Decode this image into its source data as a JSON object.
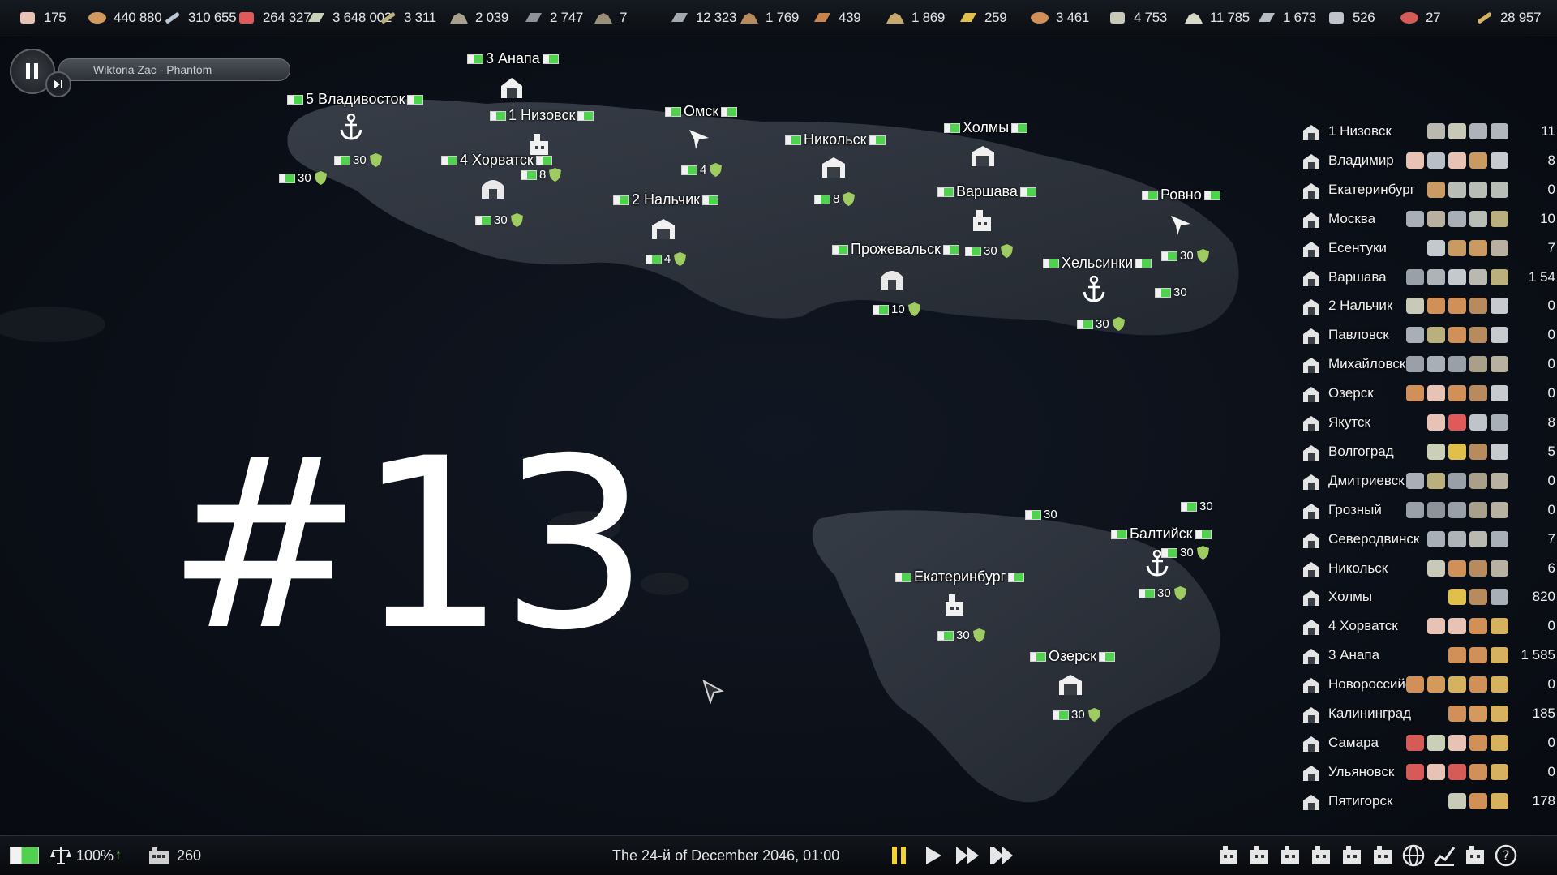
{
  "resources": [
    {
      "name": "paper-icon",
      "value": "175",
      "color": "#e8c3b5"
    },
    {
      "name": "bread-icon",
      "value": "440 880",
      "color": "#d49a5c"
    },
    {
      "name": "shovel-icon",
      "value": "310 655",
      "color": "#bcc7d6"
    },
    {
      "name": "canned-food-icon",
      "value": "264 327",
      "color": "#e05a5a"
    },
    {
      "name": "steel-icon",
      "value": "3 648 002",
      "color": "#c9d0b7"
    },
    {
      "name": "fence-icon",
      "value": "3 311",
      "color": "#b9b07e"
    },
    {
      "name": "ore-icon",
      "value": "2 039",
      "color": "#a8a08a"
    },
    {
      "name": "iron-bar-icon",
      "value": "2 747",
      "color": "#8e939a"
    },
    {
      "name": "rubble-icon",
      "value": "7",
      "color": "#9b8f78"
    },
    {
      "name": "plate-icon",
      "value": "12 323",
      "color": "#a4a9b0"
    },
    {
      "name": "potato-icon",
      "value": "1 769",
      "color": "#b88b5e"
    },
    {
      "name": "wood-icon",
      "value": "439",
      "color": "#c7844c"
    },
    {
      "name": "grain-icon",
      "value": "1 869",
      "color": "#c8a86b"
    },
    {
      "name": "gold-icon",
      "value": "259",
      "color": "#e0c04a"
    },
    {
      "name": "sausage-icon",
      "value": "3 461",
      "color": "#d09058"
    },
    {
      "name": "box-icon",
      "value": "4 753",
      "color": "#c9c9b8"
    },
    {
      "name": "cotton-icon",
      "value": "11 785",
      "color": "#d8dac8"
    },
    {
      "name": "fabric-icon",
      "value": "1 673",
      "color": "#b7bcc2"
    },
    {
      "name": "bottle-icon",
      "value": "526",
      "color": "#bfc4ca"
    },
    {
      "name": "meat-icon",
      "value": "27",
      "color": "#d65a55"
    },
    {
      "name": "wheat-icon",
      "value": "28 957",
      "color": "#d6b160"
    }
  ],
  "player": {
    "track": "Wiktoria Zac - Phantom"
  },
  "episode": "#13",
  "map_labels": {
    "anapa": "3 Анапа",
    "vladivostok": "5 Владивосток",
    "nizovsk": "1 Низовск",
    "horvatsk": "4 Хорватск",
    "omsk": "Омск",
    "nikolsk": "Никольск",
    "holmy": "Холмы",
    "nalchik": "2 Нальчик",
    "varshava": "Варшава",
    "rovno": "Ровно",
    "przhevalsk": "Прожевальск",
    "helsinki": "Хельсинки",
    "baltiysk": "Балтийск",
    "ekaterinburg": "Екатеринбург",
    "ozersk": "Озерск"
  },
  "garrisons": {
    "g_vlad_1": "30",
    "g_vlad_2": "30",
    "g_nizovsk": "8",
    "g_horv": "30",
    "g_omsk": "4",
    "g_nalch": "4",
    "g_nikolsk": "8",
    "g_varsh": "30",
    "g_przh": "10",
    "g_rovno_1": "30",
    "g_rovno_2": "30",
    "g_hels": "30",
    "g_sea_1": "30",
    "g_sea_2": "30",
    "g_balt_1": "30",
    "g_balt_2": "30",
    "g_ekat": "30",
    "g_ozersk": "30"
  },
  "settlements": [
    {
      "name": "1 Низовск",
      "count": "11",
      "goods": [
        "#b9b9b0",
        "#c8c8b8",
        "#aeb3b8",
        "#b0b6bc"
      ]
    },
    {
      "name": "Владимир",
      "count": "8",
      "goods": [
        "#e8c3b5",
        "#b8bfc7",
        "#e8c3b5",
        "#c99a62",
        "#c7cbd0"
      ]
    },
    {
      "name": "Екатеринбург",
      "count": "0",
      "goods": [
        "#c99a62",
        "#b8bdb5",
        "#b8bdb5",
        "#b8bdb5"
      ]
    },
    {
      "name": "Москва",
      "count": "10",
      "goods": [
        "#a9afb6",
        "#b8b0a0",
        "#a9afb6",
        "#b8bdb5",
        "#b9b07e"
      ]
    },
    {
      "name": "Есентуки",
      "count": "7",
      "goods": [
        "#c4c9ce",
        "#c99a62",
        "#c99a62",
        "#b8b0a0"
      ]
    },
    {
      "name": "Варшава",
      "count": "1 54",
      "goods": [
        "#9aa0a8",
        "#aeb3b8",
        "#c4c9ce",
        "#b9b9b0",
        "#b9b07e"
      ]
    },
    {
      "name": "2 Нальчик",
      "count": "0",
      "goods": [
        "#c9c9b8",
        "#d09058",
        "#d09058",
        "#b88b5e",
        "#c7cbd0"
      ]
    },
    {
      "name": "Павловск",
      "count": "0",
      "goods": [
        "#a9afb6",
        "#b9b07e",
        "#d09058",
        "#b88b5e",
        "#c7cbd0"
      ]
    },
    {
      "name": "Михайловск",
      "count": "0",
      "goods": [
        "#9aa0a8",
        "#a9afb6",
        "#9aa0a8",
        "#a8a08a",
        "#b8b0a0"
      ]
    },
    {
      "name": "Озерск",
      "count": "0",
      "goods": [
        "#d09058",
        "#e8c3b5",
        "#d09058",
        "#b88b5e",
        "#c7cbd0"
      ]
    },
    {
      "name": "Якутск",
      "count": "8",
      "goods": [
        "#e8c3b5",
        "#e05a5a",
        "#bfc4ca",
        "#a9afb6"
      ]
    },
    {
      "name": "Волгоград",
      "count": "5",
      "goods": [
        "#c9d0b7",
        "#e0c04a",
        "#b88b5e",
        "#c7cbd0"
      ]
    },
    {
      "name": "Дмитриевск",
      "count": "0",
      "goods": [
        "#a9afb6",
        "#b9b07e",
        "#9aa0a8",
        "#a8a08a",
        "#b8b0a0"
      ]
    },
    {
      "name": "Грозный",
      "count": "0",
      "goods": [
        "#9aa0a8",
        "#8e939a",
        "#9aa0a8",
        "#a8a08a",
        "#b8b0a0"
      ]
    },
    {
      "name": "Северодвинск",
      "count": "7",
      "goods": [
        "#a9afb6",
        "#aeb3b8",
        "#b9b9b0",
        "#a9afb6"
      ]
    },
    {
      "name": "Никольск",
      "count": "6",
      "goods": [
        "#c9c9b8",
        "#d09058",
        "#b88b5e",
        "#b8b0a0"
      ]
    },
    {
      "name": "Холмы",
      "count": "820",
      "goods": [
        "#e0c04a",
        "#b88b5e",
        "#a9afb6"
      ]
    },
    {
      "name": "4 Хорватск",
      "count": "0",
      "goods": [
        "#e8c3b5",
        "#e8c3b5",
        "#d09058",
        "#d6b160"
      ]
    },
    {
      "name": "3 Анапа",
      "count": "1 585",
      "goods": [
        "#d09058",
        "#d09058",
        "#d6b160"
      ]
    },
    {
      "name": "Новороссийск",
      "count": "0",
      "goods": [
        "#d09058",
        "#d49a5c",
        "#d6b160",
        "#d09058",
        "#d6b160"
      ]
    },
    {
      "name": "Калининград",
      "count": "185",
      "goods": [
        "#d09058",
        "#d49a5c",
        "#d6b160"
      ]
    },
    {
      "name": "Самара",
      "count": "0",
      "goods": [
        "#d65a55",
        "#c9d0b7",
        "#e8c3b5",
        "#d09058",
        "#d6b160"
      ]
    },
    {
      "name": "Ульяновск",
      "count": "0",
      "goods": [
        "#d65a55",
        "#e8c3b5",
        "#d65a55",
        "#d09058",
        "#d6b160"
      ]
    },
    {
      "name": "Пятигорск",
      "count": "178",
      "goods": [
        "#c9c9b8",
        "#d09058",
        "#d6b160"
      ]
    }
  ],
  "bottom": {
    "approval": "100%",
    "population": "260",
    "date": "The 24-й of December 2046, 01:00"
  },
  "toolbar_icons": [
    "gear-icon",
    "construction-icon",
    "industry-icon",
    "military-icon",
    "transport-icon",
    "trade-icon",
    "world-icon",
    "statistics-icon",
    "government-icon",
    "help-icon"
  ]
}
